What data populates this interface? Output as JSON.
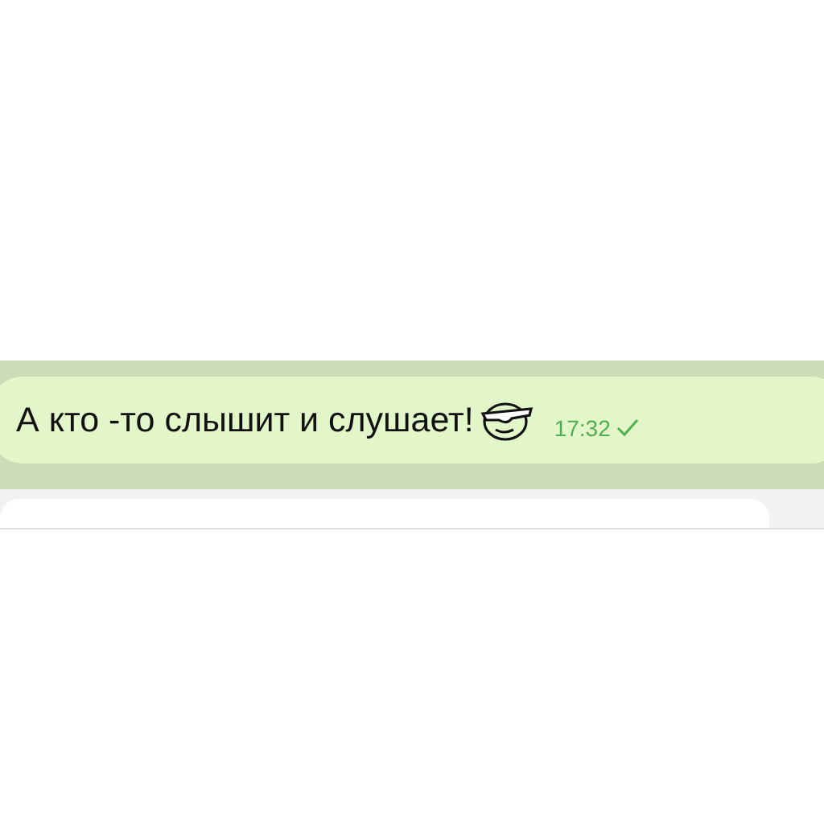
{
  "message": {
    "text": "А кто -то слышит и слушает!",
    "time": "17:32",
    "read": false
  }
}
